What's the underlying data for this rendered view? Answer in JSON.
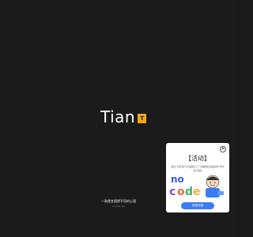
{
  "logo": {
    "text": "Tian",
    "badge": "T"
  },
  "footer": {
    "slogan": "一款便宜随便不用的心酒",
    "subtext": "tiantian.gd"
  },
  "popup": {
    "close_icon": "✕",
    "title": "【活动】",
    "description": "通过\"无代码\"平台搭建下个工程的所活动集智\"无代码\"活动",
    "art_text": "no code",
    "button_label": "查看详情"
  },
  "colors": {
    "background": "#1b1b1b",
    "accent": "#f2a51a",
    "button": "#3b7bf6"
  }
}
